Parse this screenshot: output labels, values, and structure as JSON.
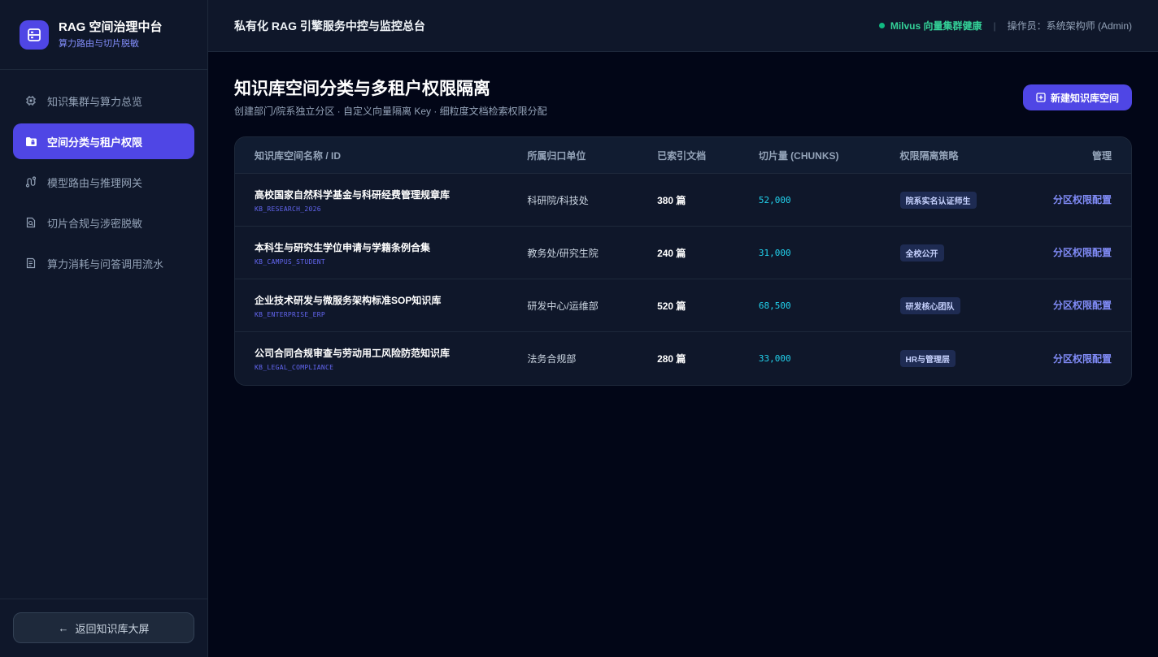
{
  "brand": {
    "title": "RAG 空间治理中台",
    "subtitle": "算力路由与切片脱敏"
  },
  "nav": [
    {
      "label": "知识集群与算力总览",
      "icon": "cpu-chip-icon",
      "active": false
    },
    {
      "label": "空间分类与租户权限",
      "icon": "folder-lock-icon",
      "active": true
    },
    {
      "label": "模型路由与推理网关",
      "icon": "route-icon",
      "active": false
    },
    {
      "label": "切片合规与涉密脱敏",
      "icon": "document-search-icon",
      "active": false
    },
    {
      "label": "算力消耗与问答调用流水",
      "icon": "receipt-list-icon",
      "active": false
    }
  ],
  "footer": {
    "back_label": "返回知识库大屏",
    "back_icon": "arrow-left-icon"
  },
  "topbar": {
    "title": "私有化 RAG 引擎服务中控与监控总台",
    "status": "Milvus 向量集群健康",
    "separator": "|",
    "operator": "操作员：系统架构师 (Admin)"
  },
  "page": {
    "title": "知识库空间分类与多租户权限隔离",
    "subtitle": "创建部门/院系独立分区 · 自定义向量隔离 Key · 细粒度文档检索权限分配",
    "new_button": "新建知识库空间"
  },
  "table": {
    "headers": [
      "知识库空间名称 / ID",
      "所属归口单位",
      "已索引文档",
      "切片量 (CHUNKS)",
      "权限隔离策略",
      "管理"
    ],
    "rows": [
      {
        "name": "高校国家自然科学基金与科研经费管理规章库",
        "id": "KB_RESEARCH_2026",
        "unit": "科研院/科技处",
        "docs": "380 篇",
        "chunks": "52,000",
        "policy": "院系实名认证师生",
        "action": "分区权限配置"
      },
      {
        "name": "本科生与研究生学位申请与学籍条例合集",
        "id": "KB_CAMPUS_STUDENT",
        "unit": "教务处/研究生院",
        "docs": "240 篇",
        "chunks": "31,000",
        "policy": "全校公开",
        "action": "分区权限配置"
      },
      {
        "name": "企业技术研发与微服务架构标准SOP知识库",
        "id": "KB_ENTERPRISE_ERP",
        "unit": "研发中心/运维部",
        "docs": "520 篇",
        "chunks": "68,500",
        "policy": "研发核心团队",
        "action": "分区权限配置"
      },
      {
        "name": "公司合同合规审查与劳动用工风险防范知识库",
        "id": "KB_LEGAL_COMPLIANCE",
        "unit": "法务合规部",
        "docs": "280 篇",
        "chunks": "33,000",
        "policy": "HR与管理层",
        "action": "分区权限配置"
      }
    ]
  },
  "colors": {
    "accent": "#4f46e5",
    "status": "#10b981",
    "chunks": "#22d3ee"
  }
}
